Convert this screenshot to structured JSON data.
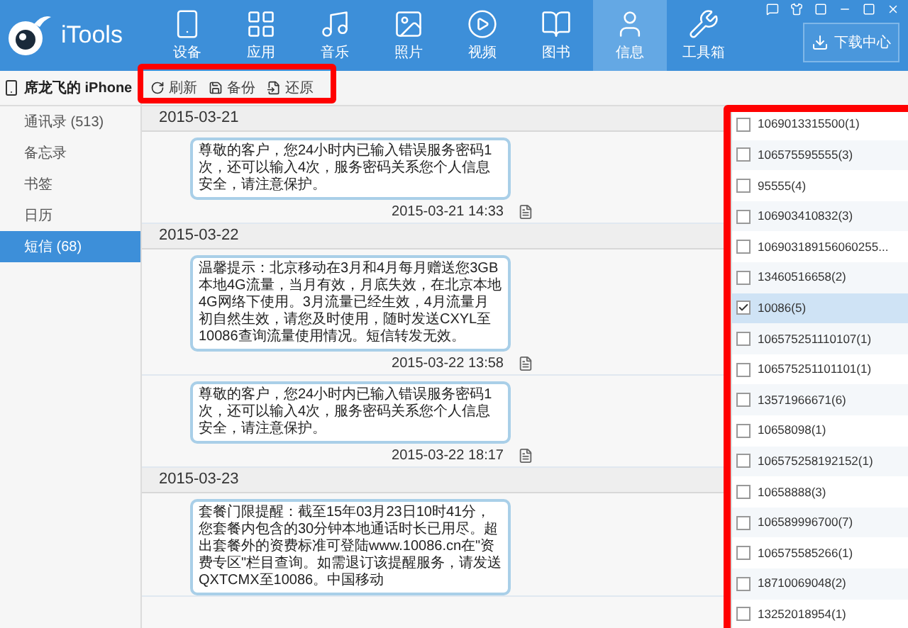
{
  "app": {
    "name": "iTools"
  },
  "nav": [
    {
      "label": "设备",
      "selected": false
    },
    {
      "label": "应用",
      "selected": false
    },
    {
      "label": "音乐",
      "selected": false
    },
    {
      "label": "照片",
      "selected": false
    },
    {
      "label": "视频",
      "selected": false
    },
    {
      "label": "图书",
      "selected": false
    },
    {
      "label": "信息",
      "selected": true
    },
    {
      "label": "工具箱",
      "selected": false
    }
  ],
  "download_button": {
    "label": "下载中心"
  },
  "device": {
    "name": "席龙飞的 iPhone"
  },
  "toolbar": [
    {
      "label": "刷新"
    },
    {
      "label": "备份"
    },
    {
      "label": "还原"
    }
  ],
  "sidebar": [
    {
      "label": "通讯录 (513)",
      "selected": false
    },
    {
      "label": "备忘录",
      "selected": false
    },
    {
      "label": "书签",
      "selected": false
    },
    {
      "label": "日历",
      "selected": false
    },
    {
      "label": "短信 (68)",
      "selected": true
    }
  ],
  "messages": [
    {
      "kind": "date",
      "text": "2015-03-21"
    },
    {
      "kind": "message",
      "text": "尊敬的客户，您24小时内已输入错误服务密码1次，还可以输入4次，服务密码关系您个人信息安全，请注意保护。",
      "time": "2015-03-21 14:33"
    },
    {
      "kind": "date",
      "text": "2015-03-22"
    },
    {
      "kind": "message",
      "text": "温馨提示：北京移动在3月和4月每月赠送您3GB本地4G流量，当月有效，月底失效，在北京本地4G网络下使用。3月流量已经生效，4月流量月初自然生效，请您及时使用，随时发送CXYL至10086查询流量使用情况。短信转发无效。",
      "time": "2015-03-22 13:58"
    },
    {
      "kind": "message",
      "text": "尊敬的客户，您24小时内已输入错误服务密码1次，还可以输入4次，服务密码关系您个人信息安全，请注意保护。",
      "time": "2015-03-22 18:17"
    },
    {
      "kind": "date",
      "text": "2015-03-23"
    },
    {
      "kind": "message",
      "text": "套餐门限提醒：截至15年03月23日10时41分，您套餐内包含的30分钟本地通话时长已用尽。超出套餐外的资费标准可登陆www.10086.cn在\"资费专区\"栏目查询。如需退订该提醒服务，请发送QXTCMX至10086。中国移动"
    }
  ],
  "contacts": [
    {
      "label": "1069013315500(1)",
      "checked": false,
      "selected": false
    },
    {
      "label": "106575595555(3)",
      "checked": false,
      "selected": false
    },
    {
      "label": "95555(4)",
      "checked": false,
      "selected": false
    },
    {
      "label": "106903410832(3)",
      "checked": false,
      "selected": false
    },
    {
      "label": "106903189156060255...",
      "checked": false,
      "selected": false
    },
    {
      "label": "13460516658(2)",
      "checked": false,
      "selected": false
    },
    {
      "label": "10086(5)",
      "checked": true,
      "selected": true
    },
    {
      "label": "106575251110107(1)",
      "checked": false,
      "selected": false
    },
    {
      "label": "106575251101101(1)",
      "checked": false,
      "selected": false
    },
    {
      "label": "13571966671(6)",
      "checked": false,
      "selected": false
    },
    {
      "label": "10658098(1)",
      "checked": false,
      "selected": false
    },
    {
      "label": "106575258192152(1)",
      "checked": false,
      "selected": false
    },
    {
      "label": "10658888(3)",
      "checked": false,
      "selected": false
    },
    {
      "label": "106589996700(7)",
      "checked": false,
      "selected": false
    },
    {
      "label": "106575585266(1)",
      "checked": false,
      "selected": false
    },
    {
      "label": "18710069048(2)",
      "checked": false,
      "selected": false
    },
    {
      "label": "13252018954(1)",
      "checked": false,
      "selected": false
    }
  ]
}
